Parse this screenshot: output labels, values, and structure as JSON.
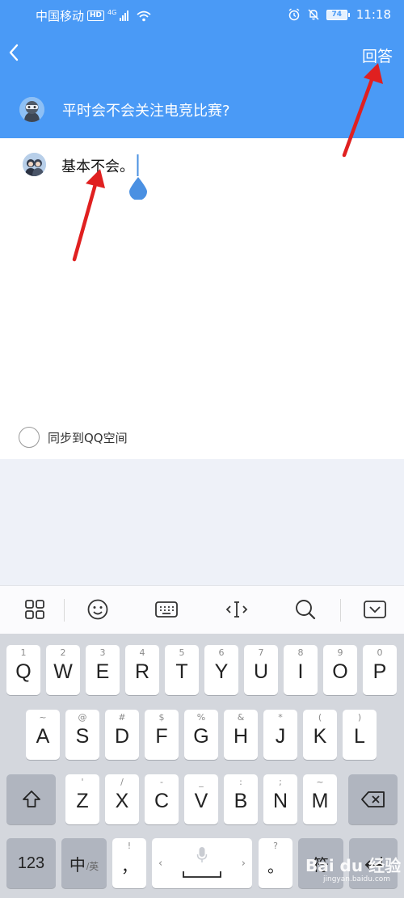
{
  "status_bar": {
    "carrier": "中国移动",
    "hd": "HD",
    "signal": "4G",
    "battery": "74",
    "time": "11:18"
  },
  "header": {
    "answer_label": "回答",
    "question": "平时会不会关注电竞比赛?"
  },
  "answer": {
    "text": "基本不会。"
  },
  "sync": {
    "label": "同步到QQ空间"
  },
  "keyboard": {
    "row1": [
      {
        "hint": "1",
        "key": "Q"
      },
      {
        "hint": "2",
        "key": "W"
      },
      {
        "hint": "3",
        "key": "E"
      },
      {
        "hint": "4",
        "key": "R"
      },
      {
        "hint": "5",
        "key": "T"
      },
      {
        "hint": "6",
        "key": "Y"
      },
      {
        "hint": "7",
        "key": "U"
      },
      {
        "hint": "8",
        "key": "I"
      },
      {
        "hint": "9",
        "key": "O"
      },
      {
        "hint": "0",
        "key": "P"
      }
    ],
    "row2": [
      {
        "hint": "~",
        "key": "A"
      },
      {
        "hint": "@",
        "key": "S"
      },
      {
        "hint": "#",
        "key": "D"
      },
      {
        "hint": "$",
        "key": "F"
      },
      {
        "hint": "%",
        "key": "G"
      },
      {
        "hint": "&",
        "key": "H"
      },
      {
        "hint": "*",
        "key": "J"
      },
      {
        "hint": "(",
        "key": "K"
      },
      {
        "hint": ")",
        "key": "L"
      }
    ],
    "row3": [
      {
        "hint": "'",
        "key": "Z"
      },
      {
        "hint": "/",
        "key": "X"
      },
      {
        "hint": "-",
        "key": "C"
      },
      {
        "hint": "_",
        "key": "V"
      },
      {
        "hint": ":",
        "key": "B"
      },
      {
        "hint": ";",
        "key": "N"
      },
      {
        "hint": "~",
        "key": "M"
      }
    ],
    "numbers_key": "123",
    "lang_key_main": "中",
    "lang_key_sub": "/英",
    "comma_key": "，",
    "comma_hint": "!",
    "period_key": "。",
    "period_hint": "?",
    "symbol_key": "符",
    "space_hint_left": "‹",
    "space_hint_right": "›"
  },
  "watermark": {
    "text": "Bai du 经验",
    "sub": "jingyan.baidu.com"
  },
  "colors": {
    "header_blue": "#4a9af6",
    "arrow_red": "#e02020",
    "cursor_blue": "#4a90e2"
  }
}
